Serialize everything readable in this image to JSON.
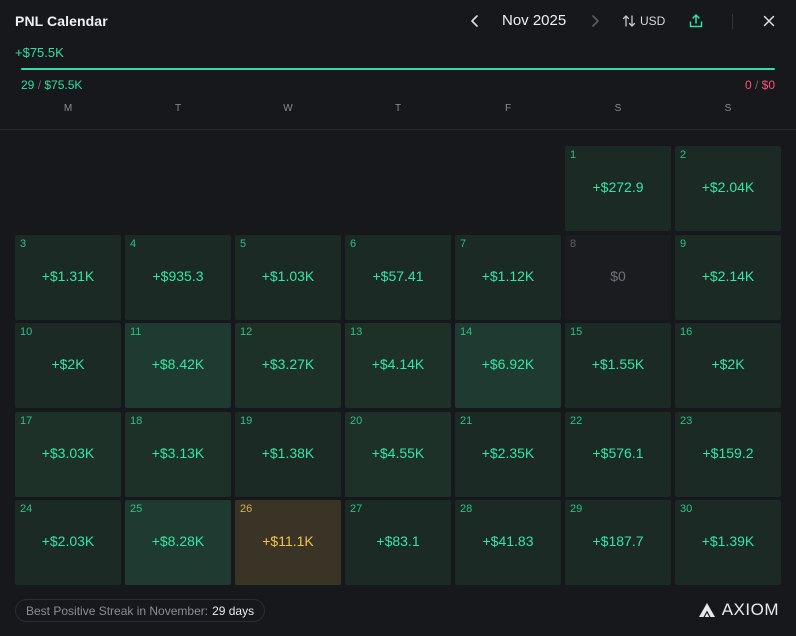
{
  "header": {
    "title": "PNL Calendar",
    "month": "Nov 2025",
    "currency": "USD"
  },
  "summary": {
    "total": "+$75.5K",
    "win_days": "29",
    "win_amount": "$75.5K",
    "loss_days": "0",
    "loss_amount": "$0",
    "win_ratio": 1.0
  },
  "weekdays": [
    "M",
    "T",
    "W",
    "T",
    "F",
    "S",
    "S"
  ],
  "days": [
    {
      "day": "1",
      "value": "+$272.9",
      "level": "lvl1"
    },
    {
      "day": "2",
      "value": "+$2.04K",
      "level": "lvl1"
    },
    {
      "day": "3",
      "value": "+$1.31K",
      "level": "lvl1"
    },
    {
      "day": "4",
      "value": "+$935.3",
      "level": "lvl1"
    },
    {
      "day": "5",
      "value": "+$1.03K",
      "level": "lvl1"
    },
    {
      "day": "6",
      "value": "+$57.41",
      "level": "lvl1"
    },
    {
      "day": "7",
      "value": "+$1.12K",
      "level": "lvl1"
    },
    {
      "day": "8",
      "value": "$0",
      "level": "zero"
    },
    {
      "day": "9",
      "value": "+$2.14K",
      "level": "lvl1"
    },
    {
      "day": "10",
      "value": "+$2K",
      "level": "lvl1"
    },
    {
      "day": "11",
      "value": "+$8.42K",
      "level": "lvl3"
    },
    {
      "day": "12",
      "value": "+$3.27K",
      "level": "lvl2"
    },
    {
      "day": "13",
      "value": "+$4.14K",
      "level": "lvl2"
    },
    {
      "day": "14",
      "value": "+$6.92K",
      "level": "lvl3"
    },
    {
      "day": "15",
      "value": "+$1.55K",
      "level": "lvl1"
    },
    {
      "day": "16",
      "value": "+$2K",
      "level": "lvl1"
    },
    {
      "day": "17",
      "value": "+$3.03K",
      "level": "lvl2"
    },
    {
      "day": "18",
      "value": "+$3.13K",
      "level": "lvl2"
    },
    {
      "day": "19",
      "value": "+$1.38K",
      "level": "lvl1"
    },
    {
      "day": "20",
      "value": "+$4.55K",
      "level": "lvl2"
    },
    {
      "day": "21",
      "value": "+$2.35K",
      "level": "lvl1"
    },
    {
      "day": "22",
      "value": "+$576.1",
      "level": "lvl1"
    },
    {
      "day": "23",
      "value": "+$159.2",
      "level": "lvl1"
    },
    {
      "day": "24",
      "value": "+$2.03K",
      "level": "lvl1"
    },
    {
      "day": "25",
      "value": "+$8.28K",
      "level": "lvl3"
    },
    {
      "day": "26",
      "value": "+$11.1K",
      "level": "hi"
    },
    {
      "day": "27",
      "value": "+$83.1",
      "level": "lvl1"
    },
    {
      "day": "28",
      "value": "+$41.83",
      "level": "lvl1"
    },
    {
      "day": "29",
      "value": "+$187.7",
      "level": "lvl1"
    },
    {
      "day": "30",
      "value": "+$1.39K",
      "level": "lvl1"
    }
  ],
  "footer": {
    "streak_label": "Best Positive Streak in November:",
    "streak_value": "29 days",
    "logo_text": "AXIOM"
  },
  "colors": {
    "positive": "#2fe0a2",
    "negative": "#ff4f7e",
    "highlight": "#f7c24d"
  },
  "icons": [
    "chevron-left-icon",
    "chevron-right-icon",
    "sort-arrows-icon",
    "share-upload-icon",
    "close-icon",
    "axiom-logo-icon"
  ]
}
